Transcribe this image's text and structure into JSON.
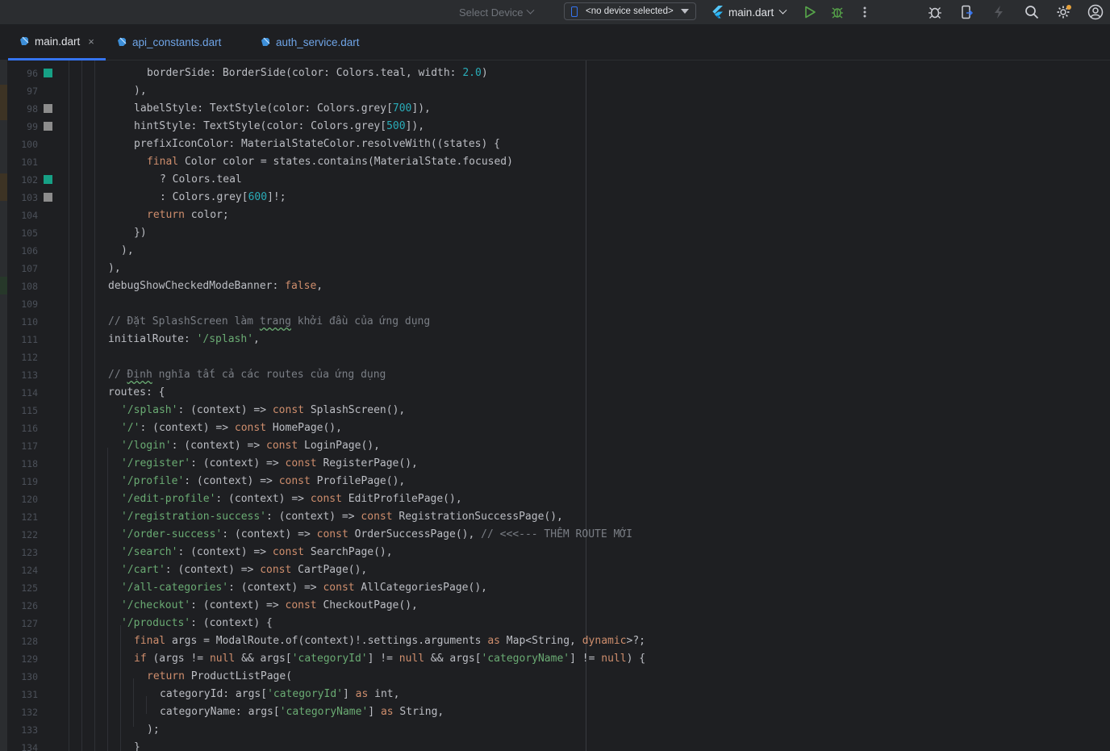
{
  "toolbar": {
    "select_device": "Select Device",
    "device_dropdown": "<no device selected>",
    "run_config": "main.dart"
  },
  "tabs": [
    {
      "label": "main.dart",
      "active": true
    },
    {
      "label": "api_constants.dart",
      "active": false
    },
    {
      "label": "auth_service.dart",
      "active": false
    }
  ],
  "tab_close": "×",
  "colors": {
    "accent": "#3574f0",
    "keyword": "#cf8e6d",
    "string": "#6aab73",
    "number": "#2aacb8",
    "comment": "#7a7e85",
    "gutter_teal": "#16a085",
    "gutter_grey": "#8c8c8c"
  },
  "editor": {
    "gutter_marks": [
      {
        "line": 96,
        "color": "teal"
      },
      {
        "line": 98,
        "color": "grey"
      },
      {
        "line": 99,
        "color": "grey"
      },
      {
        "line": 102,
        "color": "teal"
      },
      {
        "line": 103,
        "color": "grey"
      }
    ],
    "lines": [
      {
        "n": 96,
        "indent": 10,
        "tokens": [
          {
            "t": "borderSide: BorderSide(color: Colors.teal, width: "
          },
          {
            "t": "2.0",
            "c": "num"
          },
          {
            "t": ")"
          }
        ]
      },
      {
        "n": 97,
        "indent": 8,
        "tokens": [
          {
            "t": "),"
          }
        ]
      },
      {
        "n": 98,
        "indent": 8,
        "tokens": [
          {
            "t": "labelStyle: TextStyle(color: Colors.grey["
          },
          {
            "t": "700",
            "c": "num"
          },
          {
            "t": "]),"
          }
        ]
      },
      {
        "n": 99,
        "indent": 8,
        "tokens": [
          {
            "t": "hintStyle: TextStyle(color: Colors.grey["
          },
          {
            "t": "500",
            "c": "num"
          },
          {
            "t": "]),"
          }
        ]
      },
      {
        "n": 100,
        "indent": 8,
        "tokens": [
          {
            "t": "prefixIconColor: MaterialStateColor.resolveWith((states) {"
          }
        ]
      },
      {
        "n": 101,
        "indent": 10,
        "tokens": [
          {
            "t": "final",
            "c": "kw"
          },
          {
            "t": " Color color = states.contains(MaterialState.focused)"
          }
        ]
      },
      {
        "n": 102,
        "indent": 12,
        "tokens": [
          {
            "t": "? Colors.teal"
          }
        ]
      },
      {
        "n": 103,
        "indent": 12,
        "tokens": [
          {
            "t": ": Colors.grey["
          },
          {
            "t": "600",
            "c": "num"
          },
          {
            "t": "]!;"
          }
        ]
      },
      {
        "n": 104,
        "indent": 10,
        "tokens": [
          {
            "t": "return",
            "c": "kw"
          },
          {
            "t": " color;"
          }
        ]
      },
      {
        "n": 105,
        "indent": 8,
        "tokens": [
          {
            "t": "})"
          }
        ]
      },
      {
        "n": 106,
        "indent": 6,
        "tokens": [
          {
            "t": "),"
          }
        ]
      },
      {
        "n": 107,
        "indent": 4,
        "tokens": [
          {
            "t": "),"
          }
        ]
      },
      {
        "n": 108,
        "indent": 4,
        "tokens": [
          {
            "t": "debugShowCheckedModeBanner: "
          },
          {
            "t": "false",
            "c": "kw"
          },
          {
            "t": ","
          }
        ]
      },
      {
        "n": 109,
        "indent": 0,
        "tokens": []
      },
      {
        "n": 110,
        "indent": 4,
        "tokens": [
          {
            "t": "// Đặt SplashScreen làm ",
            "c": "cm"
          },
          {
            "t": "trang",
            "c": "cm typo"
          },
          {
            "t": " khởi đầu của ứng dụng",
            "c": "cm"
          }
        ]
      },
      {
        "n": 111,
        "indent": 4,
        "tokens": [
          {
            "t": "initialRoute: "
          },
          {
            "t": "'/splash'",
            "c": "str"
          },
          {
            "t": ","
          }
        ]
      },
      {
        "n": 112,
        "indent": 0,
        "tokens": []
      },
      {
        "n": 113,
        "indent": 4,
        "tokens": [
          {
            "t": "// ",
            "c": "cm"
          },
          {
            "t": "Định",
            "c": "cm typo"
          },
          {
            "t": " nghĩa tất cả các routes của ứng dụng",
            "c": "cm"
          }
        ]
      },
      {
        "n": 114,
        "indent": 4,
        "tokens": [
          {
            "t": "routes: {"
          }
        ]
      },
      {
        "n": 115,
        "indent": 6,
        "tokens": [
          {
            "t": "'/splash'",
            "c": "str"
          },
          {
            "t": ": (context) => "
          },
          {
            "t": "const",
            "c": "kw"
          },
          {
            "t": " SplashScreen(),"
          }
        ]
      },
      {
        "n": 116,
        "indent": 6,
        "tokens": [
          {
            "t": "'/'",
            "c": "str"
          },
          {
            "t": ": (context) => "
          },
          {
            "t": "const",
            "c": "kw"
          },
          {
            "t": " HomePage(),"
          }
        ]
      },
      {
        "n": 117,
        "indent": 6,
        "tokens": [
          {
            "t": "'/login'",
            "c": "str"
          },
          {
            "t": ": (context) => "
          },
          {
            "t": "const",
            "c": "kw"
          },
          {
            "t": " LoginPage(),"
          }
        ]
      },
      {
        "n": 118,
        "indent": 6,
        "tokens": [
          {
            "t": "'/register'",
            "c": "str"
          },
          {
            "t": ": (context) => "
          },
          {
            "t": "const",
            "c": "kw"
          },
          {
            "t": " RegisterPage(),"
          }
        ]
      },
      {
        "n": 119,
        "indent": 6,
        "tokens": [
          {
            "t": "'/profile'",
            "c": "str"
          },
          {
            "t": ": (context) => "
          },
          {
            "t": "const",
            "c": "kw"
          },
          {
            "t": " ProfilePage(),"
          }
        ]
      },
      {
        "n": 120,
        "indent": 6,
        "tokens": [
          {
            "t": "'/edit-profile'",
            "c": "str"
          },
          {
            "t": ": (context) => "
          },
          {
            "t": "const",
            "c": "kw"
          },
          {
            "t": " EditProfilePage(),"
          }
        ]
      },
      {
        "n": 121,
        "indent": 6,
        "tokens": [
          {
            "t": "'/registration-success'",
            "c": "str"
          },
          {
            "t": ": (context) => "
          },
          {
            "t": "const",
            "c": "kw"
          },
          {
            "t": " RegistrationSuccessPage(),"
          }
        ]
      },
      {
        "n": 122,
        "indent": 6,
        "tokens": [
          {
            "t": "'/order-success'",
            "c": "str"
          },
          {
            "t": ": (context) => "
          },
          {
            "t": "const",
            "c": "kw"
          },
          {
            "t": " OrderSuccessPage(), "
          },
          {
            "t": "// <<<--- THÊM ROUTE MỚI",
            "c": "cm"
          }
        ]
      },
      {
        "n": 123,
        "indent": 6,
        "tokens": [
          {
            "t": "'/search'",
            "c": "str"
          },
          {
            "t": ": (context) => "
          },
          {
            "t": "const",
            "c": "kw"
          },
          {
            "t": " SearchPage(),"
          }
        ]
      },
      {
        "n": 124,
        "indent": 6,
        "tokens": [
          {
            "t": "'/cart'",
            "c": "str"
          },
          {
            "t": ": (context) => "
          },
          {
            "t": "const",
            "c": "kw"
          },
          {
            "t": " CartPage(),"
          }
        ]
      },
      {
        "n": 125,
        "indent": 6,
        "tokens": [
          {
            "t": "'/all-categories'",
            "c": "str"
          },
          {
            "t": ": (context) => "
          },
          {
            "t": "const",
            "c": "kw"
          },
          {
            "t": " AllCategoriesPage(),"
          }
        ]
      },
      {
        "n": 126,
        "indent": 6,
        "tokens": [
          {
            "t": "'/checkout'",
            "c": "str"
          },
          {
            "t": ": (context) => "
          },
          {
            "t": "const",
            "c": "kw"
          },
          {
            "t": " CheckoutPage(),"
          }
        ]
      },
      {
        "n": 127,
        "indent": 6,
        "tokens": [
          {
            "t": "'/products'",
            "c": "str"
          },
          {
            "t": ": (context) {"
          }
        ]
      },
      {
        "n": 128,
        "indent": 8,
        "tokens": [
          {
            "t": "final",
            "c": "kw"
          },
          {
            "t": " args = ModalRoute.of(context)!.settings.arguments "
          },
          {
            "t": "as",
            "c": "kw"
          },
          {
            "t": " Map<String, "
          },
          {
            "t": "dynamic",
            "c": "kw"
          },
          {
            "t": ">?;"
          }
        ]
      },
      {
        "n": 129,
        "indent": 8,
        "tokens": [
          {
            "t": "if",
            "c": "kw"
          },
          {
            "t": " (args != "
          },
          {
            "t": "null",
            "c": "kw"
          },
          {
            "t": " && args["
          },
          {
            "t": "'categoryId'",
            "c": "str"
          },
          {
            "t": "] != "
          },
          {
            "t": "null",
            "c": "kw"
          },
          {
            "t": " && args["
          },
          {
            "t": "'categoryName'",
            "c": "str"
          },
          {
            "t": "] != "
          },
          {
            "t": "null",
            "c": "kw"
          },
          {
            "t": ") {"
          }
        ]
      },
      {
        "n": 130,
        "indent": 10,
        "tokens": [
          {
            "t": "return",
            "c": "kw"
          },
          {
            "t": " ProductListPage("
          }
        ]
      },
      {
        "n": 131,
        "indent": 12,
        "tokens": [
          {
            "t": "categoryId: args["
          },
          {
            "t": "'categoryId'",
            "c": "str"
          },
          {
            "t": "] "
          },
          {
            "t": "as",
            "c": "kw"
          },
          {
            "t": " int,"
          }
        ]
      },
      {
        "n": 132,
        "indent": 12,
        "tokens": [
          {
            "t": "categoryName: args["
          },
          {
            "t": "'categoryName'",
            "c": "str"
          },
          {
            "t": "] "
          },
          {
            "t": "as",
            "c": "kw"
          },
          {
            "t": " String,"
          }
        ]
      },
      {
        "n": 133,
        "indent": 10,
        "tokens": [
          {
            "t": ");"
          }
        ]
      },
      {
        "n": 134,
        "indent": 8,
        "tokens": [
          {
            "t": "}"
          }
        ]
      }
    ]
  }
}
